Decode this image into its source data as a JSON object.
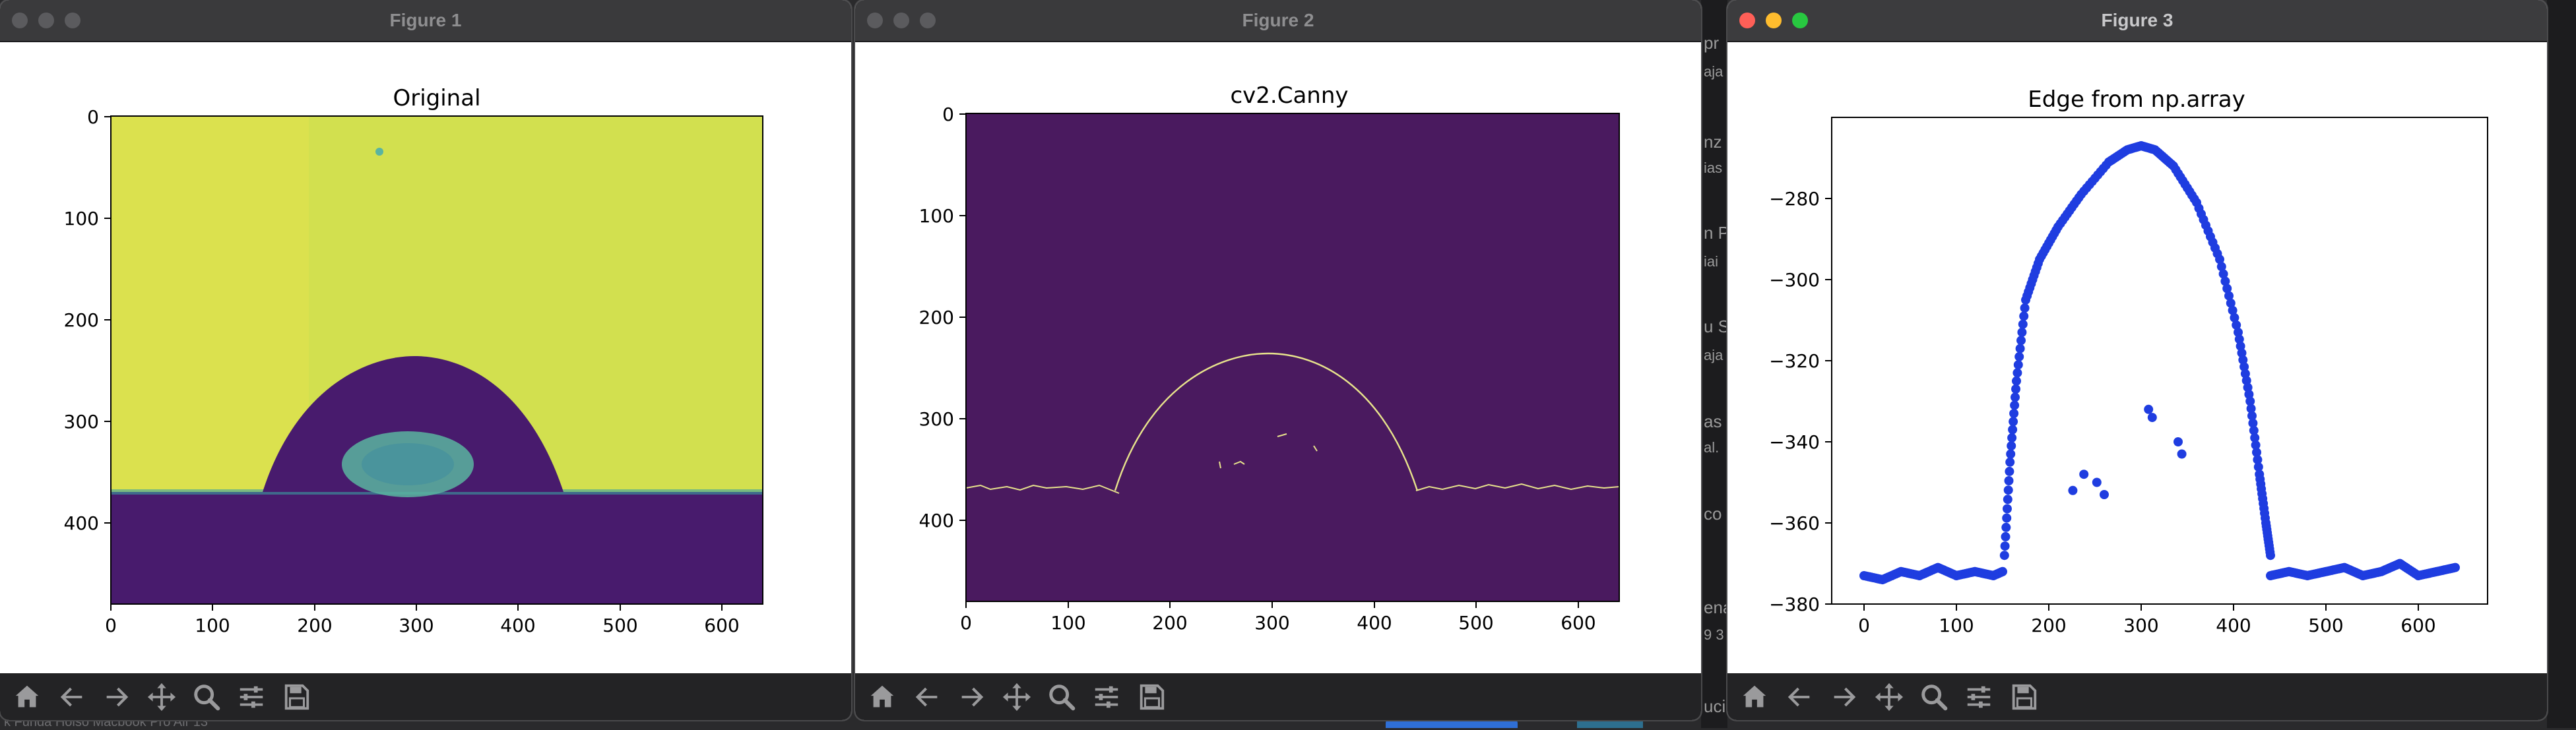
{
  "desktop": {
    "fragments": [
      "pr",
      "aja",
      "nz",
      "ias",
      "n P",
      "iai",
      "u S",
      "aja",
      "as",
      "al.",
      "co",
      "ena",
      "9 3",
      "uci",
      "k Funda Hoiso Macbook Pro Air 13"
    ]
  },
  "windows": [
    {
      "title": "Figure 1",
      "active": false,
      "chart_data": {
        "type": "image",
        "title": "Original",
        "xticks": [
          "0",
          "100",
          "200",
          "300",
          "400",
          "500",
          "600"
        ],
        "yticks": [
          "0",
          "100",
          "200",
          "300",
          "400"
        ],
        "xlim": [
          0,
          640
        ],
        "ylim": [
          480,
          0
        ],
        "colormap": "viridis",
        "colors": {
          "background": "#d2e04f",
          "substrate": "#481b6d",
          "droplet": "#481b6d",
          "reflection": "#5ab4a0"
        },
        "droplet": {
          "left_contact_x": 150,
          "right_contact_x": 445,
          "apex_x": 298,
          "apex_y": 267,
          "baseline_y": 372
        }
      }
    },
    {
      "title": "Figure 2",
      "active": false,
      "chart_data": {
        "type": "image",
        "title": "cv2.Canny",
        "xticks": [
          "0",
          "100",
          "200",
          "300",
          "400",
          "500",
          "600"
        ],
        "yticks": [
          "0",
          "100",
          "200",
          "300",
          "400"
        ],
        "xlim": [
          0,
          640
        ],
        "ylim": [
          480,
          0
        ],
        "colors": {
          "background": "#4a1a5f",
          "edge": "#e8e48c"
        },
        "edge_arc": {
          "left_contact_x": 148,
          "right_contact_x": 443,
          "apex_x": 297,
          "apex_y": 267,
          "baseline_y": 372
        }
      }
    },
    {
      "title": "Figure 3",
      "active": true,
      "chart_data": {
        "type": "scatter",
        "title": "Edge from np.array",
        "xticks": [
          "0",
          "100",
          "200",
          "300",
          "400",
          "500",
          "600"
        ],
        "yticks": [
          "−280",
          "−300",
          "−320",
          "−340",
          "−360",
          "−380"
        ],
        "xlim": [
          -35,
          675
        ],
        "ylim": [
          -380,
          -260
        ],
        "color": "#1f3de0",
        "series": [
          {
            "x": [
              0,
              20,
              40,
              60,
              80,
              100,
              120,
              140,
              150
            ],
            "y": [
              -373,
              -374,
              -372,
              -373,
              -371,
              -373,
              -372,
              -373,
              -372
            ]
          },
          {
            "x": [
              152,
              158,
              165,
              175,
              190,
              210,
              235,
              265,
              285,
              300,
              315,
              335,
              360,
              385,
              405,
              418,
              428,
              435,
              440
            ],
            "y": [
              -368,
              -345,
              -325,
              -305,
              -295,
              -287,
              -279,
              -271,
              -268,
              -267,
              -268,
              -272,
              -281,
              -295,
              -313,
              -330,
              -348,
              -360,
              -368
            ]
          },
          {
            "x": [
              440,
              460,
              480,
              500,
              520,
              540,
              560,
              580,
              600,
              620,
              640
            ],
            "y": [
              -373,
              -372,
              -373,
              -372,
              -371,
              -373,
              -372,
              -370,
              -373,
              -372,
              -371
            ]
          },
          {
            "x": [
              226,
              238,
              252,
              260,
              308,
              312,
              340,
              344
            ],
            "y": [
              -352,
              -348,
              -350,
              -353,
              -332,
              -334,
              -340,
              -343
            ]
          }
        ]
      }
    }
  ],
  "toolbar": {
    "buttons": [
      "home-icon",
      "back-arrow-icon",
      "forward-arrow-icon",
      "pan-icon",
      "zoom-icon",
      "configure-subplots-icon",
      "save-icon"
    ]
  }
}
